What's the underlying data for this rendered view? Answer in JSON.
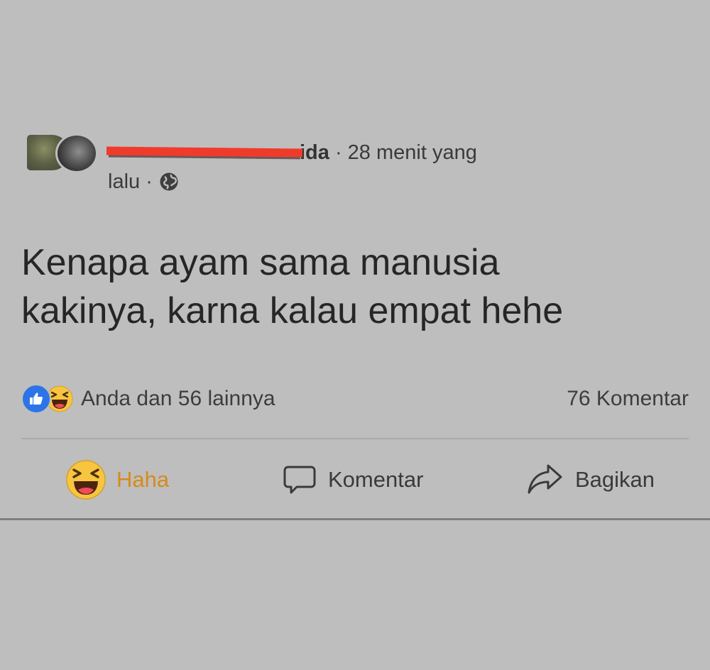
{
  "post": {
    "author_visible_suffix": "ida",
    "time_line1": " · 28 menit yang",
    "time_line2": "lalu · ",
    "privacy_icon": "globe-icon",
    "text_line1": "Kenapa ayam sama manusia",
    "text_line2": "kakinya, karna kalau empat hehe"
  },
  "summary": {
    "reactions": [
      "like-icon",
      "haha-icon"
    ],
    "reactors_text": "Anda dan 56 lainnya",
    "comments_count_text": "76 Komentar"
  },
  "actions": {
    "haha_label": "Haha",
    "comment_label": "Komentar",
    "share_label": "Bagikan"
  },
  "colors": {
    "background": "#bebebe",
    "redaction": "#f13b2a",
    "like_blue": "#2d74e8",
    "haha_orange": "#d88a1c",
    "emoji_yellow": "#f7c53f"
  }
}
